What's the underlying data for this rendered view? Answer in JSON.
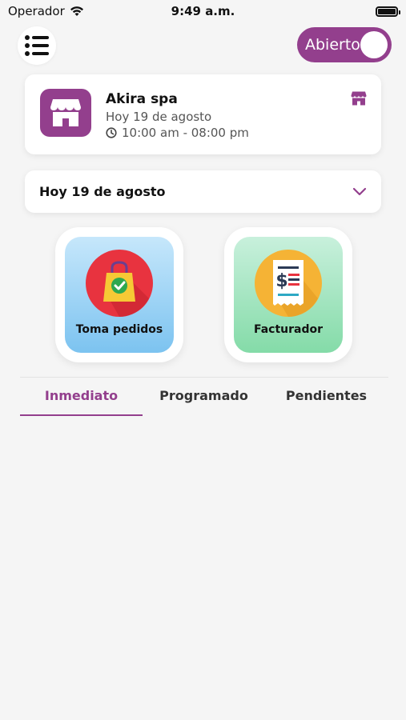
{
  "status_bar": {
    "carrier": "Operador",
    "time": "9:49 a.m."
  },
  "header": {
    "menu_icon": "list-icon",
    "toggle_label": "Abierto",
    "toggle_on": true
  },
  "store": {
    "name": "Akira spa",
    "date": "Hoy 19 de agosto",
    "hours": "10:00 am - 08:00 pm",
    "logo_icon": "storefront-icon"
  },
  "date_selector": {
    "label": "Hoy 19 de agosto",
    "icon": "chevron-down-icon"
  },
  "actions": [
    {
      "label": "Toma pedidos",
      "icon": "shopping-bag-check-icon"
    },
    {
      "label": "Facturador",
      "icon": "receipt-icon"
    }
  ],
  "tabs": [
    {
      "label": "Inmediato",
      "active": true
    },
    {
      "label": "Programado",
      "active": false
    },
    {
      "label": "Pendientes",
      "active": false
    }
  ],
  "colors": {
    "brand": "#933f8d",
    "background": "#f5f5f5"
  }
}
